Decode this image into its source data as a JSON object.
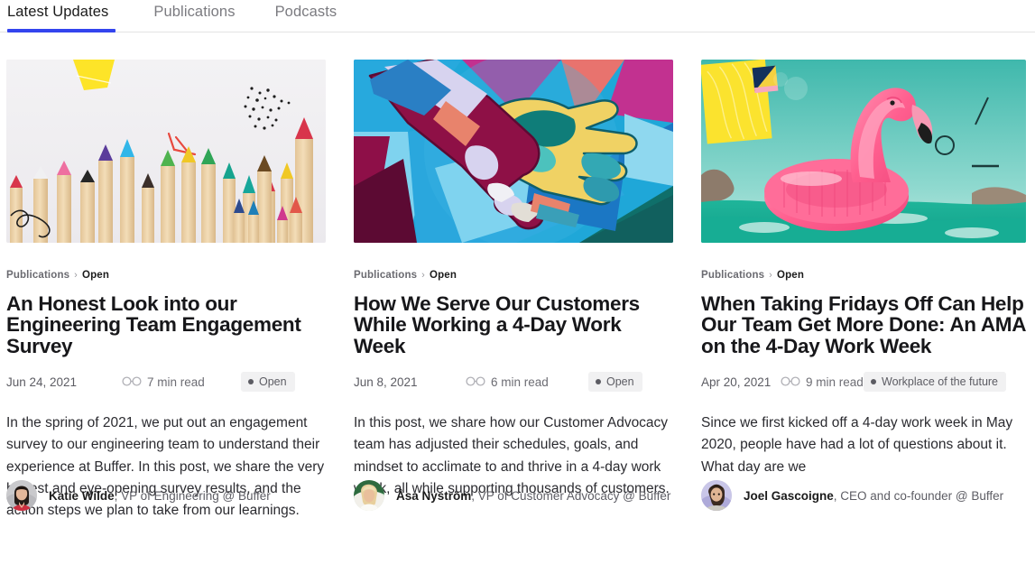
{
  "tabs": [
    {
      "label": "Latest Updates",
      "active": true
    },
    {
      "label": "Publications",
      "active": false
    },
    {
      "label": "Podcasts",
      "active": false
    }
  ],
  "theme": {
    "accent": "#3344ee",
    "text": "#1b1b1b",
    "muted": "#5c5c63",
    "badge_bg": "#f1f1f2",
    "divider": "#e3e3e3"
  },
  "cards": [
    {
      "image_alt": "colored-pencils-photo",
      "breadcrumb": {
        "category": "Publications",
        "separator": "›",
        "subcategory": "Open"
      },
      "title": "An Honest Look into our Engineering Team Engagement Survey",
      "date": "Jun 24, 2021",
      "read_time": "7 min read",
      "badge": "Open",
      "excerpt": "In the spring of 2021, we put out an engagement survey to our engineering team to understand their experience at Buffer. In this post, we share the very honest and eye-opening survey results, and the action steps we plan to take from our learnings.",
      "author": {
        "name": "Katie Wilde",
        "role": ", VP of Engineering @ Buffer",
        "avatar_alt": "katie-wilde-avatar"
      }
    },
    {
      "image_alt": "geometric-hands-mural-illustration",
      "breadcrumb": {
        "category": "Publications",
        "separator": "›",
        "subcategory": "Open"
      },
      "title": "How We Serve Our Customers While Working a 4-Day Work Week",
      "date": "Jun 8, 2021",
      "read_time": "6 min read",
      "badge": "Open",
      "excerpt": "In this post, we share how our Customer Advocacy team has adjusted their schedules, goals, and mindset to acclimate to and thrive in a 4-day work week, all while supporting thousands of customers.",
      "author": {
        "name": "Åsa Nyström",
        "role": ", VP of Customer Advocacy @ Buffer",
        "avatar_alt": "asa-nystrom-avatar"
      }
    },
    {
      "image_alt": "pink-flamingo-pool-float-photo",
      "breadcrumb": {
        "category": "Publications",
        "separator": "›",
        "subcategory": "Open"
      },
      "title": "When Taking Fridays Off Can Help Our Team Get More Done: An AMA on the 4-Day Work Week",
      "date": "Apr 20, 2021",
      "read_time": "9 min read",
      "badge": "Workplace of the future",
      "excerpt": "Since we first kicked off a 4-day work week in May 2020, people have had a lot of questions about it. What day are we",
      "author": {
        "name": "Joel Gascoigne",
        "role": ", CEO and co-founder @ Buffer",
        "avatar_alt": "joel-gascoigne-avatar"
      }
    }
  ]
}
